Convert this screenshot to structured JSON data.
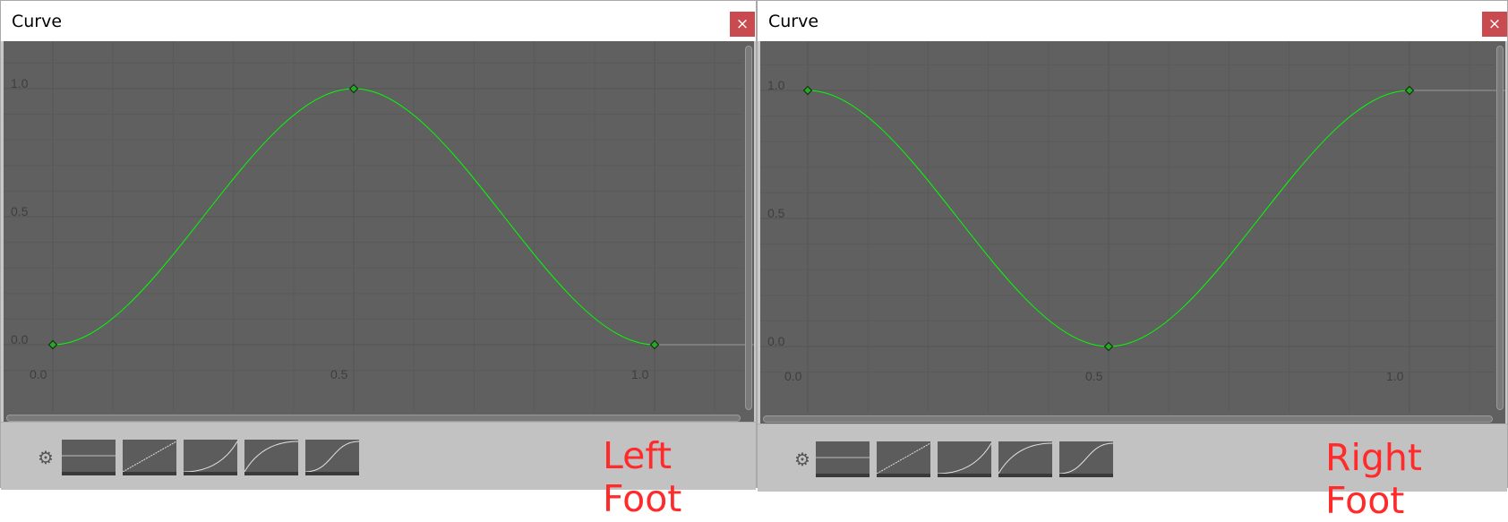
{
  "colors": {
    "graph_bg": "#606060",
    "grid_major": "#545454",
    "grid_minor": "#5a5a5a",
    "curve": "#00ff00",
    "key_fill": "#2aa52a",
    "axis_text": "#3e3e3e",
    "label_red": "#ff2a2a",
    "close_bg": "#c94b50"
  },
  "presets": [
    {
      "icon": "preset-flat-icon"
    },
    {
      "icon": "preset-linear-icon"
    },
    {
      "icon": "preset-ease-in-icon"
    },
    {
      "icon": "preset-ease-out-icon"
    },
    {
      "icon": "preset-ease-in-out-icon"
    }
  ],
  "panels": [
    {
      "title": "Curve",
      "close_label": "×",
      "label": "Left Foot",
      "y_ticks": [
        "1.0",
        "0.5",
        "0.0"
      ],
      "x_ticks": [
        "0.0",
        "0.5",
        "1.0"
      ],
      "x_range": [
        0,
        1
      ],
      "y_range": [
        0,
        1
      ],
      "grid": true,
      "keyframes": [
        {
          "t": 0.0,
          "v": 0.0
        },
        {
          "t": 0.5,
          "v": 1.0
        },
        {
          "t": 1.0,
          "v": 0.0
        }
      ]
    },
    {
      "title": "Curve",
      "close_label": "×",
      "label": "Right Foot",
      "y_ticks": [
        "1.0",
        "0.5",
        "0.0"
      ],
      "x_ticks": [
        "0.0",
        "0.5",
        "1.0"
      ],
      "x_range": [
        0,
        1
      ],
      "y_range": [
        0,
        1
      ],
      "grid": true,
      "keyframes": [
        {
          "t": 0.0,
          "v": 1.0
        },
        {
          "t": 0.5,
          "v": 0.0
        },
        {
          "t": 1.0,
          "v": 1.0
        }
      ]
    }
  ]
}
